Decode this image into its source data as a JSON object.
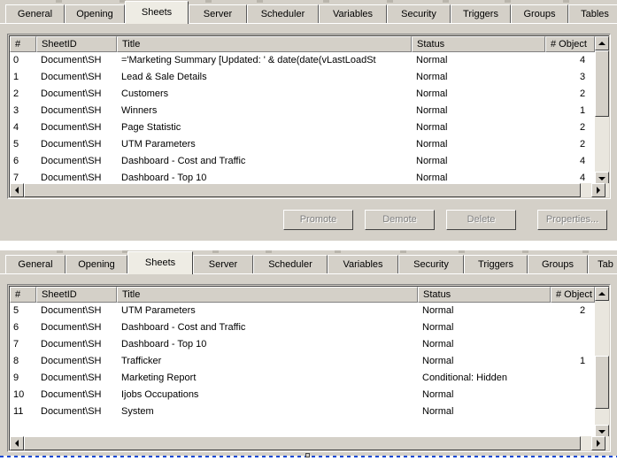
{
  "window": {
    "theme_face": "#d4d0c8",
    "theme_active_tab": "#eeece4",
    "selection_color": "#1149d4"
  },
  "panels": [
    {
      "id": "panel-top",
      "tabs": [
        {
          "label": "General",
          "active": false
        },
        {
          "label": "Opening",
          "active": false
        },
        {
          "label": "Sheets",
          "active": true
        },
        {
          "label": "Server",
          "active": false
        },
        {
          "label": "Scheduler",
          "active": false
        },
        {
          "label": "Variables",
          "active": false
        },
        {
          "label": "Security",
          "active": false
        },
        {
          "label": "Triggers",
          "active": false
        },
        {
          "label": "Groups",
          "active": false
        },
        {
          "label": "Tables",
          "active": false
        }
      ],
      "grid": {
        "columns": [
          {
            "label": "#"
          },
          {
            "label": "SheetID"
          },
          {
            "label": "Title"
          },
          {
            "label": "Status"
          },
          {
            "label": "# Object"
          }
        ],
        "rows": [
          {
            "num": "0",
            "sheetid": "Document\\SH",
            "title": "='Marketing Summary  [Updated: ' &  date(date(vLastLoadSt",
            "status": "Normal",
            "objects": "4"
          },
          {
            "num": "1",
            "sheetid": "Document\\SH",
            "title": "Lead & Sale  Details",
            "status": "Normal",
            "objects": "3"
          },
          {
            "num": "2",
            "sheetid": "Document\\SH",
            "title": "Customers",
            "status": "Normal",
            "objects": "2"
          },
          {
            "num": "3",
            "sheetid": "Document\\SH",
            "title": "Winners",
            "status": "Normal",
            "objects": "1"
          },
          {
            "num": "4",
            "sheetid": "Document\\SH",
            "title": "Page Statistic",
            "status": "Normal",
            "objects": "2"
          },
          {
            "num": "5",
            "sheetid": "Document\\SH",
            "title": "UTM Parameters",
            "status": "Normal",
            "objects": "2"
          },
          {
            "num": "6",
            "sheetid": "Document\\SH",
            "title": "Dashboard - Cost and Traffic",
            "status": "Normal",
            "objects": "4"
          },
          {
            "num": "7",
            "sheetid": "Document\\SH",
            "title": "Dashboard - Top 10",
            "status": "Normal",
            "objects": "4"
          }
        ]
      },
      "buttons": [
        {
          "label": "Promote",
          "enabled": false
        },
        {
          "label": "Demote",
          "enabled": false
        },
        {
          "label": "Delete",
          "enabled": false
        },
        {
          "label": "Properties...",
          "enabled": false
        }
      ]
    },
    {
      "id": "panel-bottom",
      "tabs": [
        {
          "label": "General",
          "active": false
        },
        {
          "label": "Opening",
          "active": false
        },
        {
          "label": "Sheets",
          "active": true
        },
        {
          "label": "Server",
          "active": false
        },
        {
          "label": "Scheduler",
          "active": false
        },
        {
          "label": "Variables",
          "active": false
        },
        {
          "label": "Security",
          "active": false
        },
        {
          "label": "Triggers",
          "active": false
        },
        {
          "label": "Groups",
          "active": false
        },
        {
          "label": "Tab",
          "active": false
        }
      ],
      "grid": {
        "columns": [
          {
            "label": "#"
          },
          {
            "label": "SheetID"
          },
          {
            "label": "Title"
          },
          {
            "label": "Status"
          },
          {
            "label": "# Object"
          }
        ],
        "rows": [
          {
            "num": "5",
            "sheetid": "Document\\SH",
            "title": "UTM Parameters",
            "status": "Normal",
            "objects": "2"
          },
          {
            "num": "6",
            "sheetid": "Document\\SH",
            "title": "Dashboard - Cost and Traffic",
            "status": "Normal",
            "objects": ""
          },
          {
            "num": "7",
            "sheetid": "Document\\SH",
            "title": "Dashboard - Top 10",
            "status": "Normal",
            "objects": ""
          },
          {
            "num": "8",
            "sheetid": "Document\\SH",
            "title": "Trafficker",
            "status": "Normal",
            "objects": "1"
          },
          {
            "num": "9",
            "sheetid": "Document\\SH",
            "title": "Marketing Report",
            "status": "Conditional: Hidden",
            "objects": ""
          },
          {
            "num": "10",
            "sheetid": "Document\\SH",
            "title": "Ijobs Occupations",
            "status": "Normal",
            "objects": ""
          },
          {
            "num": "11",
            "sheetid": "Document\\SH",
            "title": "System",
            "status": "Normal",
            "objects": ""
          }
        ]
      }
    }
  ],
  "icons": {
    "scroll_up": "scroll-up-arrow-icon",
    "scroll_down": "scroll-down-arrow-icon",
    "scroll_left": "scroll-left-arrow-icon",
    "scroll_right": "scroll-right-arrow-icon"
  }
}
